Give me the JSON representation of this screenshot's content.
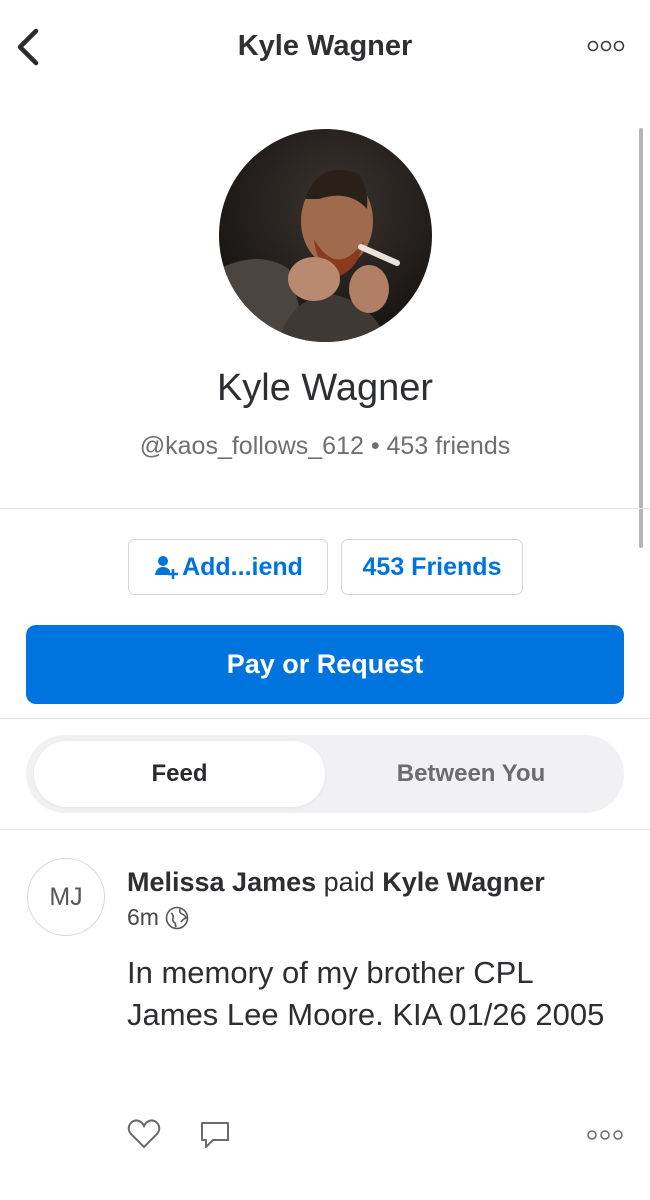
{
  "nav": {
    "title": "Kyle Wagner",
    "back_icon": "chevron-left-icon",
    "more_icon": "ellipsis-icon"
  },
  "profile": {
    "display_name": "Kyle Wagner",
    "subtitle": "@kaos_follows_612 • 453 friends"
  },
  "buttons": {
    "add_friend_label": "Add...iend",
    "friends_label": "453 Friends",
    "pay_label": "Pay or Request"
  },
  "tabs": {
    "feed": "Feed",
    "between": "Between You"
  },
  "story": {
    "initials": "MJ",
    "payer": "Melissa James",
    "verb": "paid",
    "payee": "Kyle Wagner",
    "time": "6m",
    "note": "In memory of my brother CPL James Lee Moore. KIA 01/26 2005"
  },
  "colors": {
    "accent": "#0074de",
    "text": "#2d2e32",
    "muted": "#6e6e73"
  }
}
